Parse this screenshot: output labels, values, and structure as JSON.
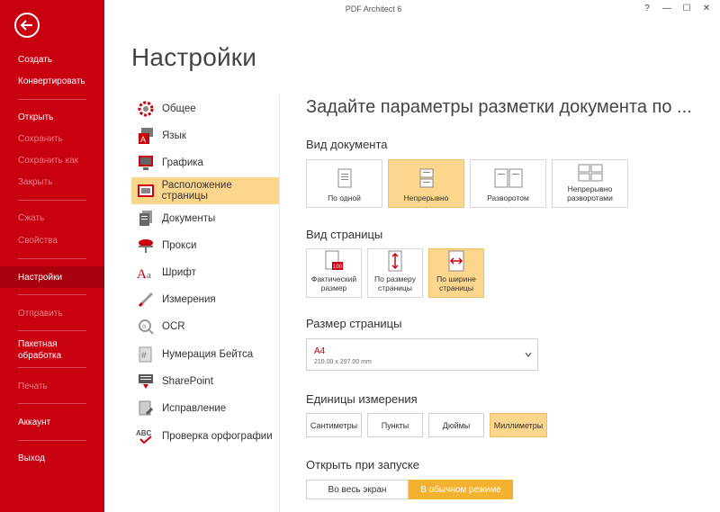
{
  "window": {
    "title": "PDF Architect 6",
    "controls": [
      "?",
      "—",
      "☐",
      "✕"
    ]
  },
  "sidebar": {
    "items": [
      {
        "label": "Создать",
        "enabled": true
      },
      {
        "label": "Конвертировать",
        "enabled": true
      },
      {
        "label": "Открыть",
        "enabled": true
      },
      {
        "label": "Сохранить",
        "enabled": false
      },
      {
        "label": "Сохранить как",
        "enabled": false
      },
      {
        "label": "Закрыть",
        "enabled": false
      },
      {
        "label": "Сжать",
        "enabled": false
      },
      {
        "label": "Свойства",
        "enabled": false
      },
      {
        "label": "Настройки",
        "enabled": true,
        "active": true
      },
      {
        "label": "Отправить",
        "enabled": false
      },
      {
        "label": "Пакетная обработка",
        "enabled": true
      },
      {
        "label": "Печать",
        "enabled": false
      },
      {
        "label": "Аккаунт",
        "enabled": true
      },
      {
        "label": "Выход",
        "enabled": true
      }
    ]
  },
  "page_title": "Настройки",
  "categories": [
    {
      "label": "Общее",
      "icon": "gear-icon"
    },
    {
      "label": "Язык",
      "icon": "language-icon"
    },
    {
      "label": "Графика",
      "icon": "monitor-icon"
    },
    {
      "label": "Расположение страницы",
      "icon": "page-layout-icon",
      "active": true
    },
    {
      "label": "Документы",
      "icon": "documents-icon"
    },
    {
      "label": "Прокси",
      "icon": "proxy-icon"
    },
    {
      "label": "Шрифт",
      "icon": "font-icon"
    },
    {
      "label": "Измерения",
      "icon": "ruler-icon"
    },
    {
      "label": "OCR",
      "icon": "ocr-icon"
    },
    {
      "label": "Нумерация Бейтса",
      "icon": "bates-icon"
    },
    {
      "label": "SharePoint",
      "icon": "sharepoint-icon"
    },
    {
      "label": "Исправление",
      "icon": "repair-icon"
    },
    {
      "label": "Проверка орфографии",
      "icon": "spellcheck-icon"
    }
  ],
  "content": {
    "heading": "Задайте параметры разметки документа по ...",
    "document_view": {
      "label": "Вид документа",
      "options": [
        {
          "label": "По одной",
          "selected": false
        },
        {
          "label": "Непрерывно",
          "selected": true
        },
        {
          "label": "Разворотом",
          "selected": false
        },
        {
          "label": "Непрерывно разворотами",
          "selected": false
        }
      ]
    },
    "page_view": {
      "label": "Вид страницы",
      "options": [
        {
          "label": "Фактический размер",
          "selected": false,
          "badge": "100"
        },
        {
          "label": "По размеру страницы",
          "selected": false
        },
        {
          "label": "По ширине страницы",
          "selected": true
        }
      ]
    },
    "page_size": {
      "label": "Размер страницы",
      "value": "A4",
      "dimensions": "210.00 x 297.00 mm"
    },
    "units": {
      "label": "Единицы измерения",
      "options": [
        {
          "label": "Сантиметры",
          "selected": false
        },
        {
          "label": "Пункты",
          "selected": false
        },
        {
          "label": "Дюймы",
          "selected": false
        },
        {
          "label": "Миллиметры",
          "selected": true
        }
      ]
    },
    "open_on_start": {
      "label": "Открыть при запуске",
      "options": [
        {
          "label": "Во весь экран",
          "selected": false
        },
        {
          "label": "В обычном режиме",
          "selected": true
        }
      ]
    }
  },
  "colors": {
    "sidebar": "#c8000f",
    "selected": "#fbd68c",
    "accent": "#f2b12e"
  }
}
